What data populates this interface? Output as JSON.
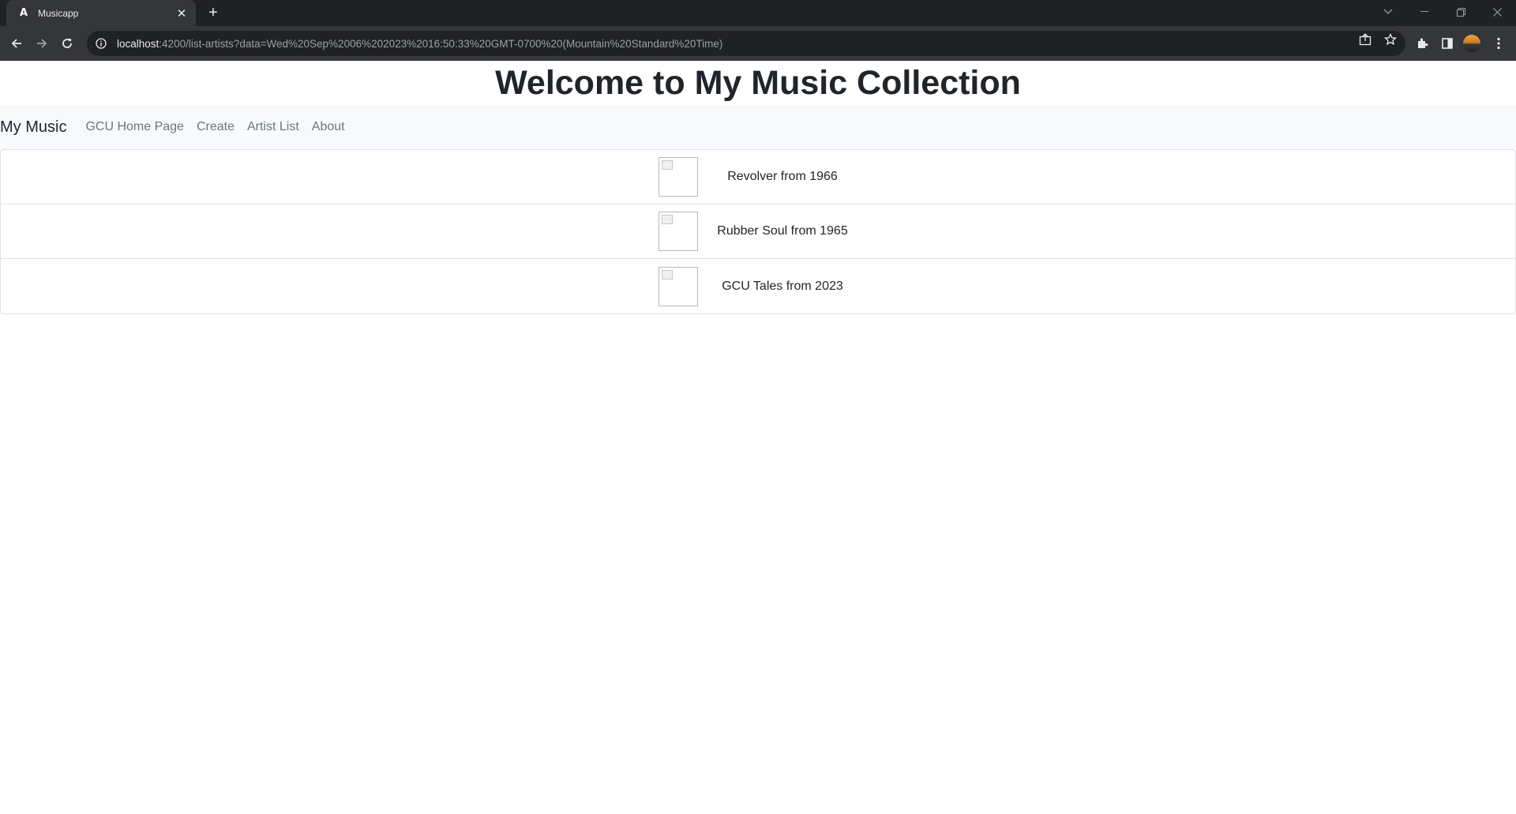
{
  "browser": {
    "tab_title": "Musicapp",
    "tab_favicon": "A",
    "url_host": "localhost",
    "url_rest": ":4200/list-artists?data=Wed%20Sep%2006%202023%2016:50:33%20GMT-0700%20(Mountain%20Standard%20Time)"
  },
  "header": {
    "title": "Welcome to My Music Collection"
  },
  "navbar": {
    "brand": "My Music",
    "links": [
      "GCU Home Page",
      "Create",
      "Artist List",
      "About"
    ]
  },
  "albums": [
    {
      "label": "Revolver from 1966"
    },
    {
      "label": "Rubber Soul from 1965"
    },
    {
      "label": "GCU Tales from 2023"
    }
  ]
}
